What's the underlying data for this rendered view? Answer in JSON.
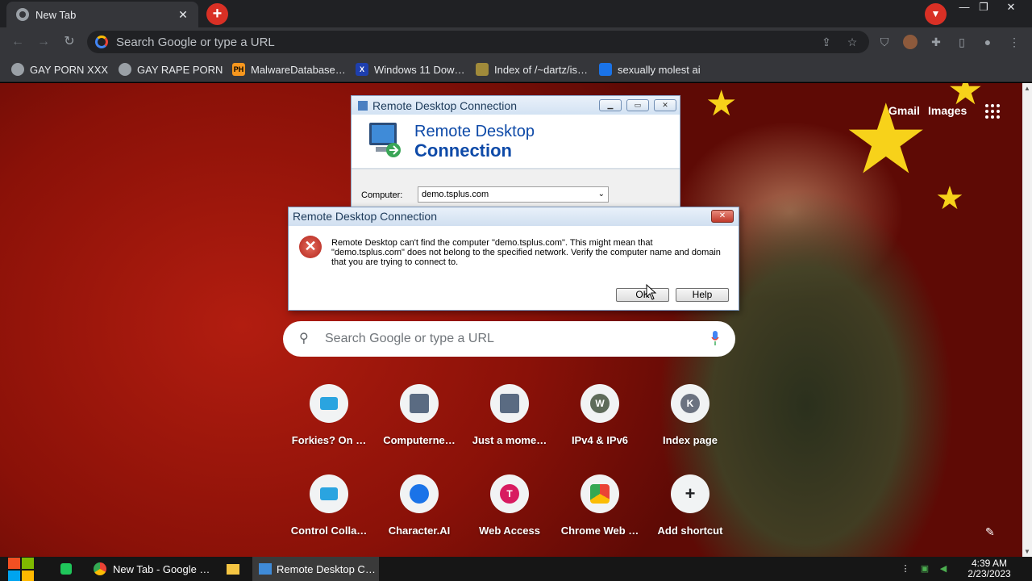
{
  "browser": {
    "tab_title": "New Tab",
    "tab_close": "✕",
    "new_tab": "+",
    "omnibox_placeholder": "Search Google or type a URL",
    "window_controls": {
      "minimize": "—",
      "restore": "❐",
      "close": "✕"
    }
  },
  "bookmarks": [
    {
      "label": "GAY PORN XXX",
      "icon": "site-icon"
    },
    {
      "label": "GAY RAPE PORN",
      "icon": "site-icon"
    },
    {
      "label": "MalwareDatabase…",
      "icon": "PH"
    },
    {
      "label": "Windows 11 Dow…",
      "icon": "X"
    },
    {
      "label": "Index of /~dartz/is…",
      "icon": "folder-icon"
    },
    {
      "label": "sexually molest ai",
      "icon": "character-ai-icon"
    }
  ],
  "newtab": {
    "gmail": "Gmail",
    "images": "Images",
    "search_placeholder": "Search Google or type a URL",
    "shortcuts": [
      {
        "label": "Forkies? On …",
        "icon": "monitor-icon"
      },
      {
        "label": "Computerne…",
        "icon": "rdp-icon"
      },
      {
        "label": "Just a mome…",
        "icon": "rdp-icon"
      },
      {
        "label": "IPv4 & IPv6",
        "icon": "W"
      },
      {
        "label": "Index page",
        "icon": "K"
      },
      {
        "label": "Control Colla…",
        "icon": "monitor-icon"
      },
      {
        "label": "Character.AI",
        "icon": "character-ai-icon"
      },
      {
        "label": "Web Access",
        "icon": "T"
      },
      {
        "label": "Chrome Web …",
        "icon": "webstore-icon"
      },
      {
        "label": "Add shortcut",
        "icon": "+"
      }
    ]
  },
  "rdc_window": {
    "title": "Remote Desktop Connection",
    "banner_line1": "Remote Desktop",
    "banner_line2": "Connection",
    "computer_label": "Computer:",
    "computer_value": "demo.tsplus.com"
  },
  "error_dialog": {
    "title": "Remote Desktop Connection",
    "message": "Remote Desktop can't find the computer \"demo.tsplus.com\". This might mean that \"demo.tsplus.com\" does not belong to the specified network.  Verify the computer name and domain that you are trying to connect to.",
    "ok_label": "OK",
    "help_label": "Help"
  },
  "taskbar": {
    "items": [
      {
        "label": "New Tab - Google …",
        "icon": "chrome-icon"
      },
      {
        "label": "",
        "icon": "folder-icon"
      },
      {
        "label": "Remote Desktop C…",
        "icon": "rdp-icon"
      }
    ],
    "time": "4:39 AM",
    "date": "2/23/2023"
  },
  "colors": {
    "accent_red": "#d93025",
    "chrome_dark": "#35363a",
    "flag_red": "#b21d10"
  }
}
